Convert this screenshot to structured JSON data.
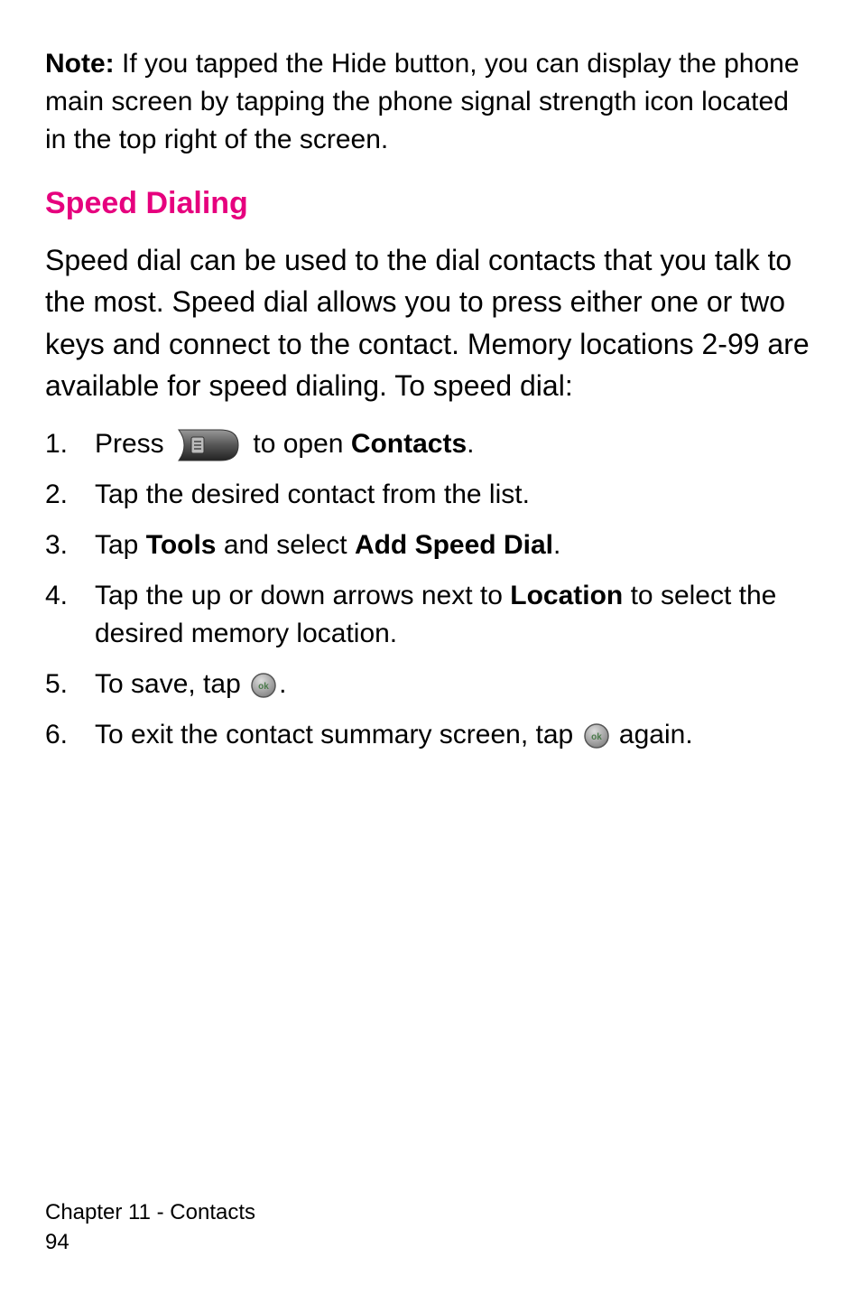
{
  "note": {
    "label": "Note:",
    "text": " If you tapped the Hide button, you can display the phone main screen by tapping the phone signal strength icon located in the top right of the screen."
  },
  "heading": "Speed Dialing",
  "intro": "Speed dial can be used to the dial contacts that you talk to the most. Speed dial allows you to press either one or two keys and connect to the contact. Memory locations 2-99 are available for speed dialing. To speed dial:",
  "steps": {
    "s1": {
      "num": "1.",
      "prefix": "Press ",
      "mid": " to open ",
      "bold": "Contacts",
      "suffix": "."
    },
    "s2": {
      "num": "2.",
      "text": "Tap the desired contact from the list."
    },
    "s3": {
      "num": "3.",
      "prefix": "Tap ",
      "bold1": "Tools",
      "mid": " and select ",
      "bold2": "Add Speed Dial",
      "suffix": "."
    },
    "s4": {
      "num": "4.",
      "prefix": "Tap the up or down arrows next to ",
      "bold": "Location",
      "suffix": " to select the desired memory location."
    },
    "s5": {
      "num": "5.",
      "prefix": "To save, tap ",
      "suffix": "."
    },
    "s6": {
      "num": "6.",
      "prefix": "To exit the contact summary screen, tap ",
      "suffix": " again."
    }
  },
  "footer": {
    "chapter": "Chapter 11 - Contacts",
    "page": "94"
  }
}
